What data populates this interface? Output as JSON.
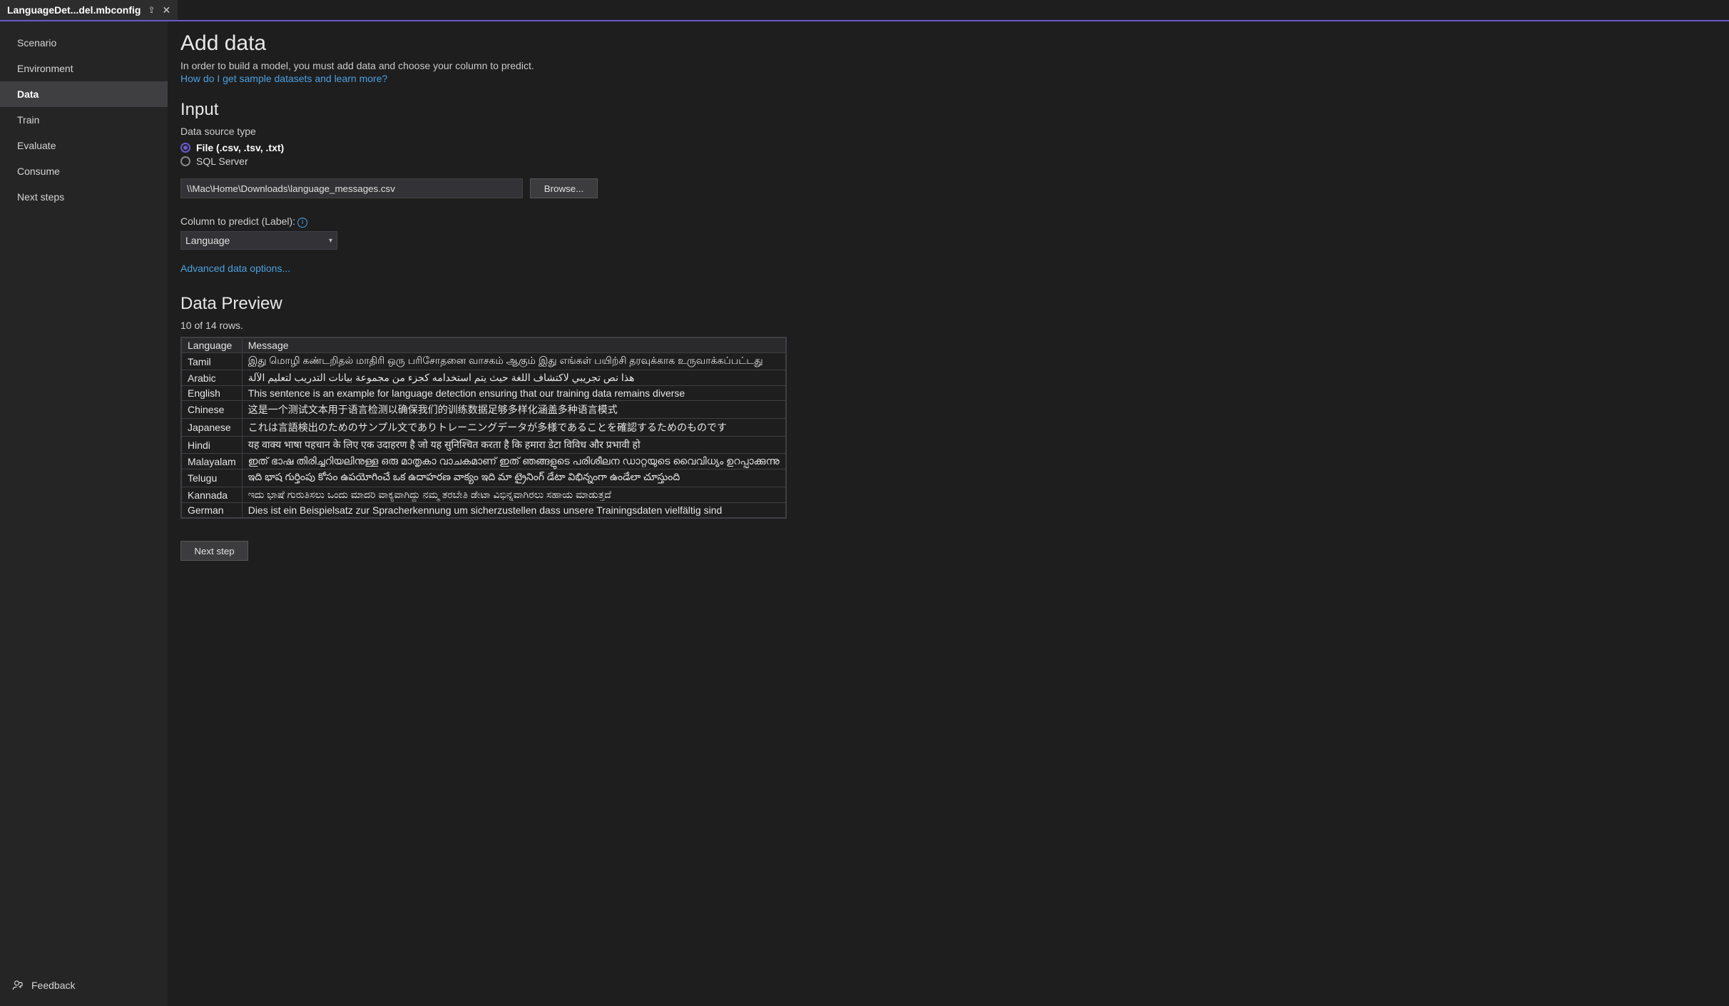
{
  "tab": {
    "title": "LanguageDet...del.mbconfig"
  },
  "sidebar": {
    "items": [
      {
        "label": "Scenario"
      },
      {
        "label": "Environment"
      },
      {
        "label": "Data"
      },
      {
        "label": "Train"
      },
      {
        "label": "Evaluate"
      },
      {
        "label": "Consume"
      },
      {
        "label": "Next steps"
      }
    ],
    "active_index": 2,
    "feedback": "Feedback"
  },
  "page": {
    "title": "Add data",
    "subtitle": "In order to build a model, you must add data and choose your column to predict.",
    "help_link": "How do I get sample datasets and learn more?",
    "input_heading": "Input",
    "data_source_label": "Data source type",
    "radio_file": "File (.csv, .tsv, .txt)",
    "radio_sql": "SQL Server",
    "file_path": "\\\\Mac\\Home\\Downloads\\language_messages.csv",
    "browse": "Browse...",
    "column_label": "Column to predict (Label):",
    "column_selected": "Language",
    "advanced": "Advanced data options...",
    "preview_heading": "Data Preview",
    "row_count": "10 of 14 rows.",
    "next_step": "Next step"
  },
  "table": {
    "headers": [
      "Language",
      "Message"
    ],
    "rows": [
      {
        "lang": "Tamil",
        "msg": "இது மொழி கண்டறிதல் மாதிரி ஒரு பரிசோதனை வாசகம் ஆகும் இது எங்கள் பயிற்சி தரவுக்காக உருவாக்கப்பட்டது"
      },
      {
        "lang": "Arabic",
        "msg": "هذا نص تجريبي لاكتشاف اللغة حيث يتم استخدامه كجزء من مجموعة بيانات التدريب لتعليم الآلة"
      },
      {
        "lang": "English",
        "msg": "This sentence is an example for language detection ensuring that our training data remains diverse"
      },
      {
        "lang": "Chinese",
        "msg": "这是一个测试文本用于语言检测以确保我们的训练数据足够多样化涵盖多种语言模式"
      },
      {
        "lang": "Japanese",
        "msg": "これは言語検出のためのサンプル文でありトレーニングデータが多様であることを確認するためのものです"
      },
      {
        "lang": "Hindi",
        "msg": "यह वाक्य भाषा पहचान के लिए एक उदाहरण है जो यह सुनिश्चित करता है कि हमारा डेटा विविध और प्रभावी हो"
      },
      {
        "lang": "Malayalam",
        "msg": "ഇത് ഭാഷ തിരിച്ചറിയലിനുള്ള ഒരു മാതൃകാ വാചകമാണ് ഇത് ഞങ്ങളുടെ പരിശീലന ഡാറ്റയുടെ വൈവിധ്യം ഉറപ്പാക്കുന്നു"
      },
      {
        "lang": "Telugu",
        "msg": "ఇది భాష గుర్తింపు కోసం ఉపయోగించే ఒక ఉదాహరణ వాక్యం ఇది మా ట్రైనింగ్ డేటా విభిన్నంగా ఉండేలా చూస్తుంది"
      },
      {
        "lang": "Kannada",
        "msg": "ಇದು ಭಾಷೆ ಗುರುತಿಸಲು ಒಂದು ಮಾದರಿ ವಾಕ್ಯವಾಗಿದ್ದು ನಮ್ಮ ತರಬೇತಿ ಡೇಟಾ ವಿಭಿನ್ನವಾಗಿರಲು ಸಹಾಯ ಮಾಡುತ್ತದೆ"
      },
      {
        "lang": "German",
        "msg": "Dies ist ein Beispielsatz zur Spracherkennung um sicherzustellen dass unsere Trainingsdaten vielfältig sind"
      }
    ]
  }
}
